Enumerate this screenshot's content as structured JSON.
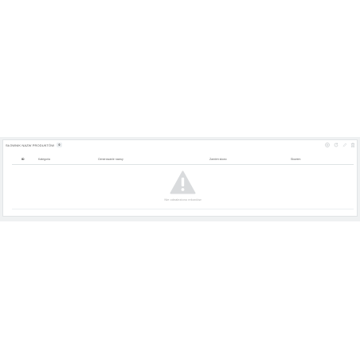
{
  "panel": {
    "title": "SŁOWNIK NAZW PRODUKTÓW",
    "count": "0"
  },
  "toolbar": {
    "icons": [
      "plus-circle-icon",
      "refresh-icon",
      "edit-icon",
      "trash-icon"
    ]
  },
  "table": {
    "columns": {
      "id": "ID",
      "category": "Kategoria",
      "generated_name": "Generowanie nazwy",
      "brand": "Zamień słowo",
      "word": "Słowem"
    },
    "empty_message": "Nie odnaleziono rekordów"
  },
  "colors": {
    "background_band": "#eff1f2",
    "panel_border": "#e1e4e6",
    "icon_gray": "#c8ccce",
    "warning_icon": "#d9dbdd"
  }
}
